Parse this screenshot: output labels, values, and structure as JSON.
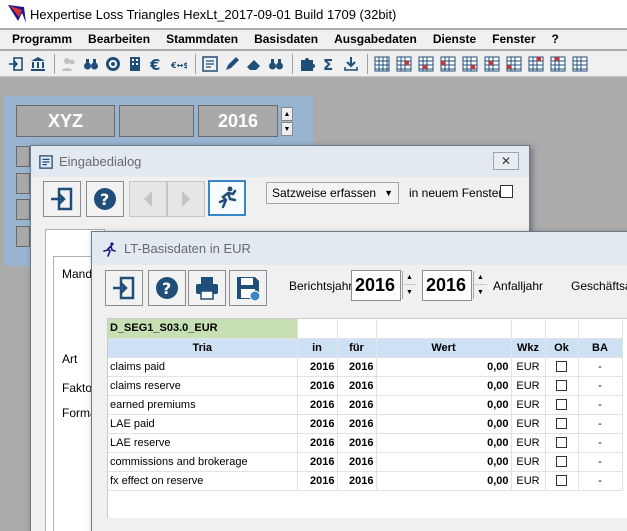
{
  "window": {
    "title": "Hexpertise Loss Triangles HexLt_2017-09-01 Build 1709 (32bit)"
  },
  "menu": [
    "Programm",
    "Bearbeiten",
    "Stammdaten",
    "Basisdaten",
    "Ausgabedaten",
    "Dienste",
    "Fenster",
    "?"
  ],
  "toolbar": {
    "icons": [
      "exit-icon",
      "bank-icon",
      "people-icon",
      "binoculars-icon",
      "globe-icon",
      "building-icon",
      "euro-icon",
      "currency-exchange-icon",
      "edit-list-icon",
      "pencil-icon",
      "eraser-icon",
      "binoculars-icon",
      "puzzle-icon",
      "sigma-icon",
      "download-icon",
      "grid-icon"
    ]
  },
  "background": {
    "company": "XYZ",
    "year": "2016"
  },
  "eingabedialog": {
    "title": "Eingabedialog",
    "mode_select": "Satzweise erfassen",
    "new_window_label": "in neuem Fenster",
    "labels": [
      "Manda",
      "Art",
      "Faktor",
      "Forma"
    ]
  },
  "basisdaten": {
    "title": "LT-Basisdaten in EUR",
    "berichtsjahr_label": "Berichtsjahr",
    "berichtsjahr": "2016",
    "anfalljahr": "2016",
    "anfalljahr_label": "Anfalljahr",
    "geschaeftsart_label": "Geschäftsar",
    "segment": "D_SEG1_S03.0_EUR",
    "columns": [
      "Tria",
      "in",
      "für",
      "Wert",
      "Wkz",
      "Ok",
      "BA"
    ],
    "rows": [
      {
        "tria": "claims paid",
        "in": "2016",
        "fuer": "2016",
        "wert": "0,00",
        "wkz": "EUR",
        "ba": "-"
      },
      {
        "tria": "claims reserve",
        "in": "2016",
        "fuer": "2016",
        "wert": "0,00",
        "wkz": "EUR",
        "ba": "-"
      },
      {
        "tria": "earned premiums",
        "in": "2016",
        "fuer": "2016",
        "wert": "0,00",
        "wkz": "EUR",
        "ba": "-"
      },
      {
        "tria": "LAE paid",
        "in": "2016",
        "fuer": "2016",
        "wert": "0,00",
        "wkz": "EUR",
        "ba": "-"
      },
      {
        "tria": "LAE reserve",
        "in": "2016",
        "fuer": "2016",
        "wert": "0,00",
        "wkz": "EUR",
        "ba": "-"
      },
      {
        "tria": "commissions and brokerage",
        "in": "2016",
        "fuer": "2016",
        "wert": "0,00",
        "wkz": "EUR",
        "ba": "-"
      },
      {
        "tria": "fx effect on reserve",
        "in": "2016",
        "fuer": "2016",
        "wert": "0,00",
        "wkz": "EUR",
        "ba": "-"
      }
    ]
  }
}
